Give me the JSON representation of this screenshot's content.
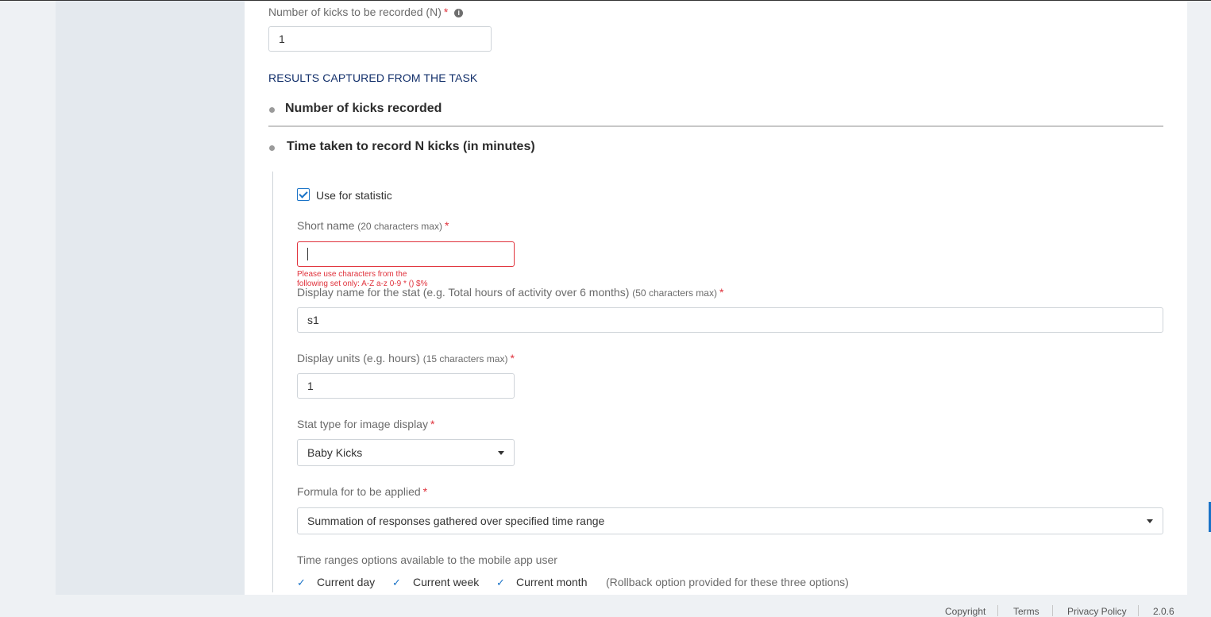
{
  "kicks_field": {
    "label": "Number of kicks to be recorded (N)",
    "required": "*",
    "info_icon": "i",
    "value": "1"
  },
  "results": {
    "heading": "RESULTS CAPTURED FROM THE TASK",
    "items": [
      {
        "title": "Number of kicks recorded"
      },
      {
        "title": "Time taken to record N kicks (in minutes)"
      }
    ]
  },
  "stat": {
    "use_for_statistic": {
      "label": "Use for statistic",
      "checked": true
    },
    "short_name": {
      "label": "Short name",
      "hint": "(20 characters max)",
      "required": "*",
      "value": "",
      "error": "Please use characters from the following set only: A-Z a-z 0-9 * () $%"
    },
    "display_name": {
      "label": "Display name for the stat (e.g. Total hours of activity over 6 months)",
      "hint": "(50 characters max)",
      "required": "*",
      "value": "s1"
    },
    "display_units": {
      "label": "Display units (e.g. hours)",
      "hint": "(15 characters max)",
      "required": "*",
      "value": "1"
    },
    "stat_type": {
      "label": "Stat type for image display",
      "required": "*",
      "value": "Baby Kicks"
    },
    "formula": {
      "label": "Formula for to be applied",
      "required": "*",
      "value": "Summation of responses gathered over specified time range"
    },
    "time_ranges": {
      "label": "Time ranges options available to the mobile app user",
      "options": [
        "Current day",
        "Current week",
        "Current month"
      ],
      "note": "(Rollback option provided for these three options)"
    }
  },
  "footer": {
    "copyright": "Copyright",
    "terms": "Terms",
    "privacy": "Privacy Policy",
    "version": "2.0.6"
  },
  "icons": {
    "tick": "✓",
    "checkbox": "checkbox-checked-icon",
    "dropdown": "caret-down-icon"
  },
  "colors": {
    "accent": "#1a73c7",
    "error": "#e0323c",
    "heading": "#13306b"
  }
}
